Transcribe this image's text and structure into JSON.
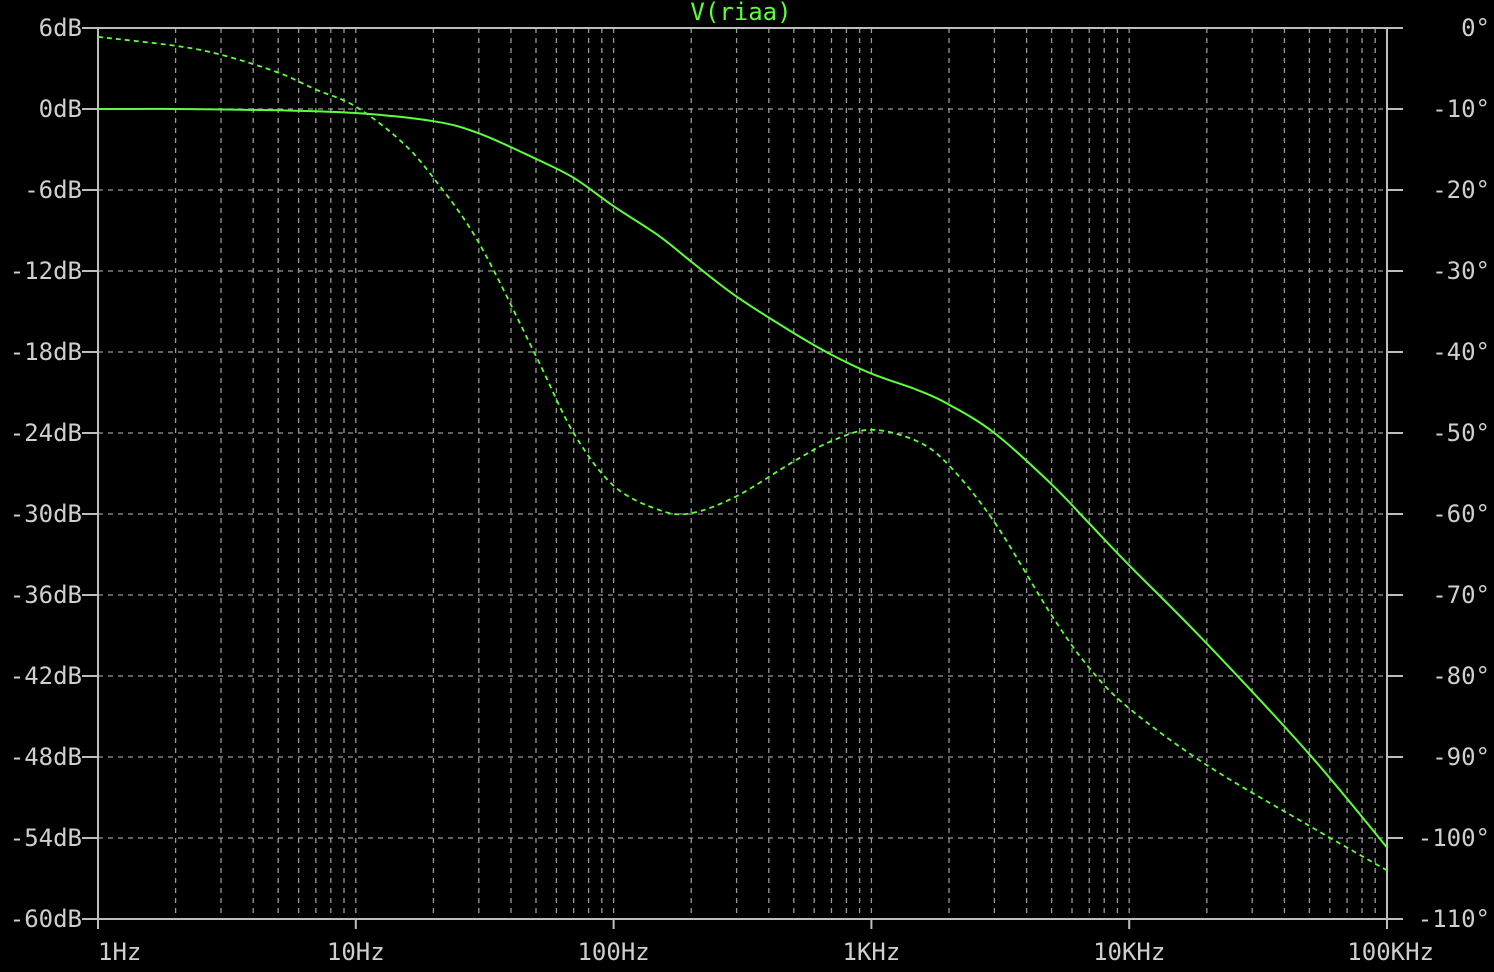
{
  "chart_data": {
    "type": "line",
    "title": "V(riaa)",
    "x_scale": "log",
    "xlim": [
      1,
      100000
    ],
    "x_ticks": [
      {
        "value": 1,
        "label": "1Hz"
      },
      {
        "value": 10,
        "label": "10Hz"
      },
      {
        "value": 100,
        "label": "100Hz"
      },
      {
        "value": 1000,
        "label": "1KHz"
      },
      {
        "value": 10000,
        "label": "10KHz"
      },
      {
        "value": 100000,
        "label": "100KHz"
      }
    ],
    "y_left": {
      "lim": [
        -60,
        6
      ],
      "ticks": [
        {
          "value": 6,
          "label": "6dB"
        },
        {
          "value": 0,
          "label": "0dB"
        },
        {
          "value": -6,
          "label": "-6dB"
        },
        {
          "value": -12,
          "label": "-12dB"
        },
        {
          "value": -18,
          "label": "-18dB"
        },
        {
          "value": -24,
          "label": "-24dB"
        },
        {
          "value": -30,
          "label": "-30dB"
        },
        {
          "value": -36,
          "label": "-36dB"
        },
        {
          "value": -42,
          "label": "-42dB"
        },
        {
          "value": -48,
          "label": "-48dB"
        },
        {
          "value": -54,
          "label": "-54dB"
        },
        {
          "value": -60,
          "label": "-60dB"
        }
      ]
    },
    "y_right": {
      "lim": [
        -110,
        0
      ],
      "ticks": [
        {
          "value": 0,
          "label": "0°"
        },
        {
          "value": -10,
          "label": "-10°"
        },
        {
          "value": -20,
          "label": "-20°"
        },
        {
          "value": -30,
          "label": "-30°"
        },
        {
          "value": -40,
          "label": "-40°"
        },
        {
          "value": -50,
          "label": "-50°"
        },
        {
          "value": -60,
          "label": "-60°"
        },
        {
          "value": -70,
          "label": "-70°"
        },
        {
          "value": -80,
          "label": "-80°"
        },
        {
          "value": -90,
          "label": "-90°"
        },
        {
          "value": -100,
          "label": "-100°"
        },
        {
          "value": -110,
          "label": "-110°"
        }
      ]
    },
    "grid": true,
    "series": [
      {
        "axis": "left",
        "style": "solid",
        "color": "#5cff3a",
        "points": [
          [
            1,
            0
          ],
          [
            2,
            0
          ],
          [
            5,
            -0.1
          ],
          [
            10,
            -0.3
          ],
          [
            20,
            -0.9
          ],
          [
            30,
            -1.8
          ],
          [
            50,
            -3.7
          ],
          [
            70,
            -5.1
          ],
          [
            100,
            -7.2
          ],
          [
            150,
            -9.4
          ],
          [
            200,
            -11.3
          ],
          [
            300,
            -13.9
          ],
          [
            500,
            -16.6
          ],
          [
            700,
            -18.2
          ],
          [
            1000,
            -19.6
          ],
          [
            1500,
            -20.8
          ],
          [
            2000,
            -21.9
          ],
          [
            3000,
            -24.0
          ],
          [
            5000,
            -27.8
          ],
          [
            7000,
            -30.7
          ],
          [
            10000,
            -33.8
          ],
          [
            20000,
            -39.6
          ],
          [
            50000,
            -47.8
          ],
          [
            100000,
            -54.7
          ]
        ]
      },
      {
        "axis": "right",
        "style": "dashed",
        "color": "#5cff3a",
        "points": [
          [
            1,
            -1.1
          ],
          [
            2,
            -2.2
          ],
          [
            3,
            -3.3
          ],
          [
            5,
            -5.5
          ],
          [
            7,
            -7.6
          ],
          [
            10,
            -9.7
          ],
          [
            15,
            -14.0
          ],
          [
            20,
            -18.5
          ],
          [
            30,
            -26.5
          ],
          [
            50,
            -40.5
          ],
          [
            70,
            -50.0
          ],
          [
            100,
            -56.5
          ],
          [
            150,
            -59.5
          ],
          [
            200,
            -59.9
          ],
          [
            300,
            -57.8
          ],
          [
            500,
            -53.5
          ],
          [
            700,
            -51.0
          ],
          [
            1000,
            -49.6
          ],
          [
            1500,
            -51.0
          ],
          [
            2000,
            -54.0
          ],
          [
            3000,
            -61.0
          ],
          [
            5000,
            -72.5
          ],
          [
            7000,
            -79.0
          ],
          [
            10000,
            -84.0
          ],
          [
            20000,
            -91.0
          ],
          [
            50000,
            -98.5
          ],
          [
            100000,
            -104.0
          ]
        ]
      }
    ]
  }
}
